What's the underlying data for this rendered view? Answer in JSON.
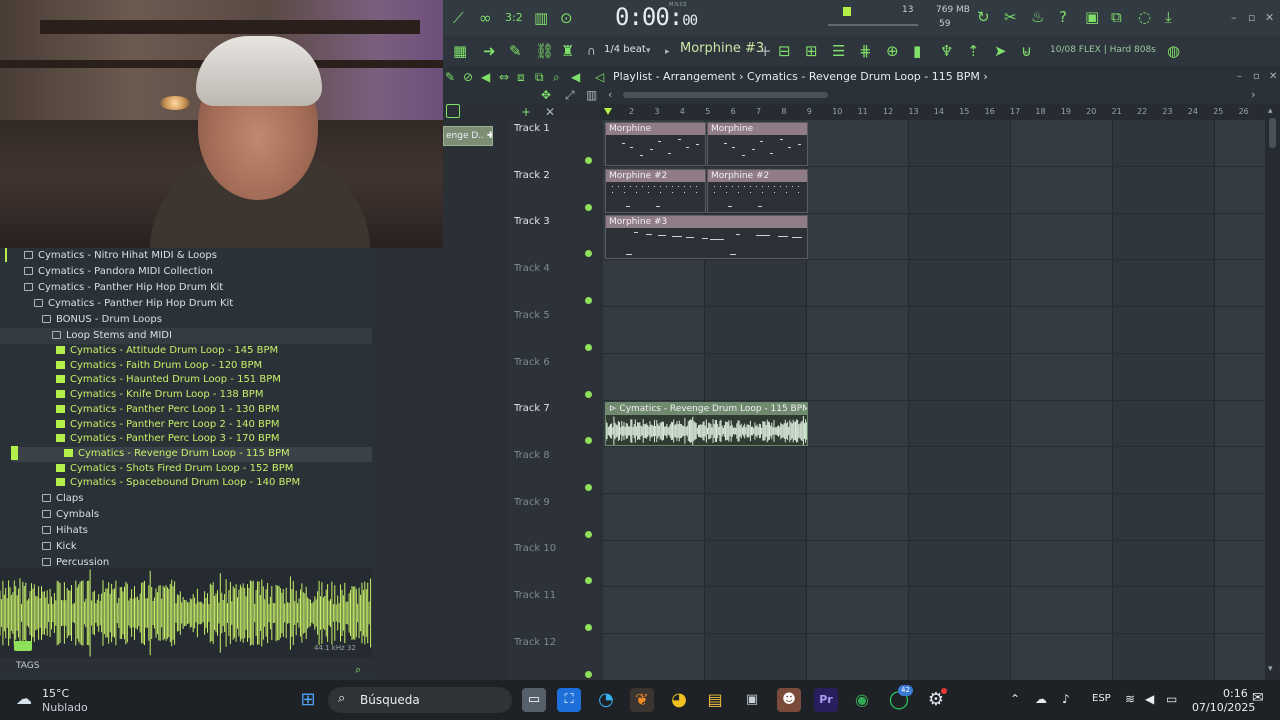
{
  "toolbar": {
    "time_main": "0:00:",
    "time_sub": "00",
    "time_unit": "M:S:CS",
    "tempo_num": "13",
    "memory": "769 MB",
    "cpu": "59",
    "snap": "1/4 beat",
    "pattern": "Morphine #3",
    "hint": "10/08  FLEX | Hard 808s"
  },
  "playlist": {
    "title": "Playlist - Arrangement › Cymatics - Revenge Drum Loop - 115 BPM ›",
    "side_clip": "enge D..",
    "ruler": [
      "2",
      "3",
      "4",
      "5",
      "6",
      "7",
      "8",
      "9",
      "10",
      "11",
      "12",
      "13",
      "14",
      "15",
      "16",
      "17",
      "18",
      "19",
      "20",
      "21",
      "22",
      "23",
      "24",
      "25",
      "26"
    ],
    "tracks": [
      "Track 1",
      "Track 2",
      "Track 3",
      "Track 4",
      "Track 5",
      "Track 6",
      "Track 7",
      "Track 8",
      "Track 9",
      "Track 10",
      "Track 11",
      "Track 12"
    ],
    "clips": {
      "t1a": "Morphine",
      "t1b": "Morphine",
      "t2a": "Morphine #2",
      "t2b": "Morphine #2",
      "t3a": "Morphine #3",
      "t7": "Cymatics - Revenge Drum Loop - 115 BPM"
    }
  },
  "browser": {
    "rows": [
      {
        "label": "Cymatics - Nitro Hihat MIDI & Loops",
        "type": "folder"
      },
      {
        "label": "Cymatics - Pandora MIDI Collection",
        "type": "folder"
      },
      {
        "label": "Cymatics - Panther Hip Hop Drum Kit",
        "type": "folder"
      },
      {
        "label": "Cymatics - Panther Hip Hop Drum Kit",
        "type": "folder"
      },
      {
        "label": "BONUS - Drum Loops",
        "type": "folder"
      },
      {
        "label": "Loop Stems and MIDI",
        "type": "folder"
      },
      {
        "label": "Cymatics - Attitude Drum Loop - 145 BPM",
        "type": "file"
      },
      {
        "label": "Cymatics - Faith Drum Loop - 120 BPM",
        "type": "file"
      },
      {
        "label": "Cymatics - Haunted Drum Loop - 151 BPM",
        "type": "file"
      },
      {
        "label": "Cymatics - Knife Drum Loop - 138 BPM",
        "type": "file"
      },
      {
        "label": "Cymatics - Panther Perc Loop 1 - 130 BPM",
        "type": "file"
      },
      {
        "label": "Cymatics - Panther Perc Loop 2 - 140 BPM",
        "type": "file"
      },
      {
        "label": "Cymatics - Panther Perc Loop 3 - 170 BPM",
        "type": "file"
      },
      {
        "label": "Cymatics - Revenge Drum Loop - 115 BPM",
        "type": "file"
      },
      {
        "label": "Cymatics - Shots Fired Drum Loop - 152 BPM",
        "type": "file"
      },
      {
        "label": "Cymatics - Spacebound Drum Loop - 140 BPM",
        "type": "file"
      },
      {
        "label": "Claps",
        "type": "folder"
      },
      {
        "label": "Cymbals",
        "type": "folder"
      },
      {
        "label": "Hihats",
        "type": "folder"
      },
      {
        "label": "Kick",
        "type": "folder"
      },
      {
        "label": "Percussion",
        "type": "folder"
      }
    ],
    "wave_info": "44.1 kHz 32",
    "tags": "TAGS"
  },
  "taskbar": {
    "temp": "15°C",
    "condition": "Nublado",
    "search": "Búsqueda",
    "lang": "ESP",
    "time": "0:16",
    "date": "07/10/2025",
    "badge": "42"
  },
  "colors": {
    "accent": "#b4f04a",
    "clip": "#8f7c86",
    "audio_clip": "#6f8a6f"
  }
}
